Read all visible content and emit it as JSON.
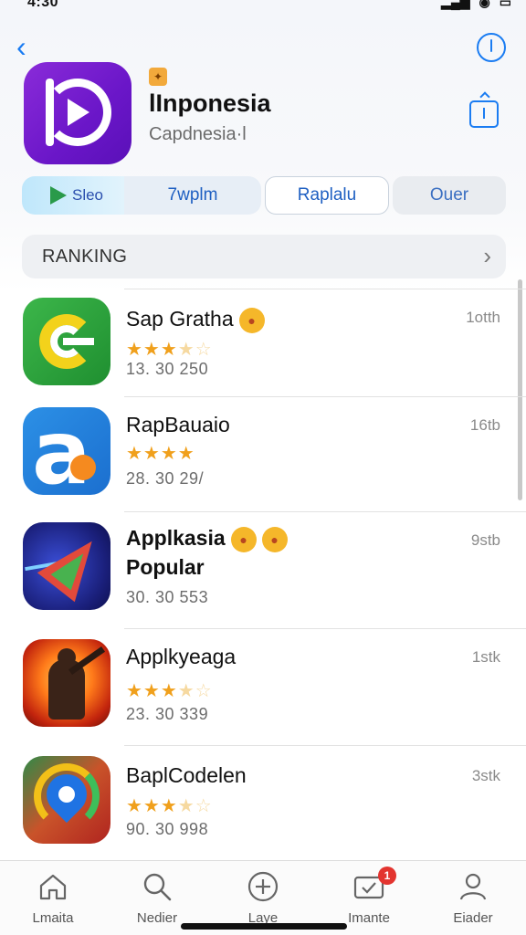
{
  "status_bar": {
    "time": "4:30",
    "icons": [
      "signal-icon",
      "wifi-icon",
      "battery-icon"
    ]
  },
  "header": {
    "app_name": "lInponesia",
    "app_subtitle": "Capdnesia·l"
  },
  "segments": [
    {
      "label": "Sleo",
      "icon": "google-play-icon"
    },
    {
      "label": "7wplm"
    },
    {
      "label": "Raplalu"
    },
    {
      "label": "Ouer"
    }
  ],
  "ranking": {
    "title": "RANKING"
  },
  "apps": [
    {
      "name": "Sap Gratha",
      "meta": "1otth",
      "rating": 3.5,
      "count": "13. 30 250",
      "emoji": true
    },
    {
      "name": "RapBauaio",
      "meta": "16tb",
      "rating": 4,
      "count": "28. 30 29/"
    },
    {
      "name": "Applkasia",
      "name2": "Popular",
      "meta": "9stb",
      "rating": null,
      "count": "30. 30 553",
      "emoji": true
    },
    {
      "name": "Applkyeaga",
      "meta": "1stk",
      "rating": 3.5,
      "count": "23. 30 339"
    },
    {
      "name": "BaplCodelen",
      "meta": "3stk",
      "rating": 3.5,
      "count": "90. 30 998"
    }
  ],
  "tabs": [
    {
      "label": "Lmaita",
      "icon": "home-icon"
    },
    {
      "label": "Nedier",
      "icon": "search-icon"
    },
    {
      "label": "Laye",
      "icon": "add-circle-icon"
    },
    {
      "label": "Imante",
      "icon": "updates-icon",
      "badge": "1"
    },
    {
      "label": "Eiader",
      "icon": "profile-icon"
    }
  ],
  "colors": {
    "accent": "#1a7cf2",
    "star": "#f0a01c",
    "badge": "#e3342f"
  }
}
